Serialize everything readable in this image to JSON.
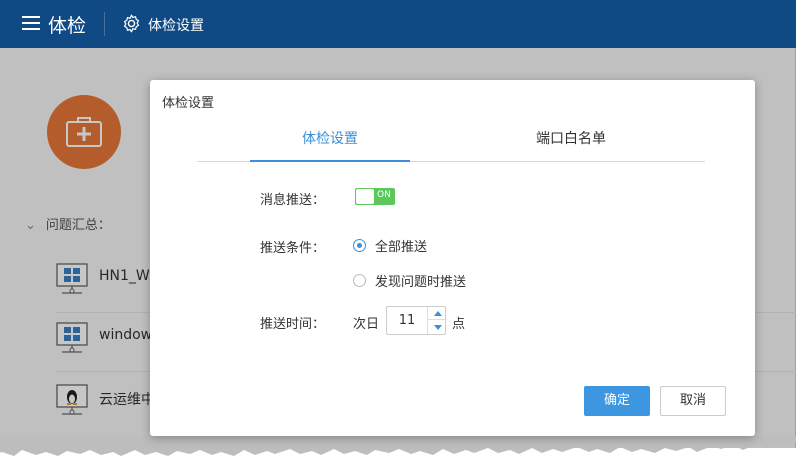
{
  "header": {
    "app_title": "体检",
    "breadcrumb": "体检设置"
  },
  "background": {
    "summary_label": "问题汇总：",
    "rows": [
      {
        "name": "HN1_W",
        "os": "windows-icon"
      },
      {
        "name": "window",
        "os": "windows-icon"
      },
      {
        "name": "云运维中",
        "os": "linux-icon"
      }
    ]
  },
  "dialog": {
    "title": "体检设置",
    "tabs": [
      {
        "label": "体检设置",
        "active": true
      },
      {
        "label": "端口白名单",
        "active": false
      }
    ],
    "push_message": {
      "label": "消息推送：",
      "toggle_text": "ON",
      "enabled": true
    },
    "push_condition": {
      "label": "推送条件：",
      "options": [
        {
          "label": "全部推送",
          "checked": true
        },
        {
          "label": "发现问题时推送",
          "checked": false
        }
      ]
    },
    "push_time": {
      "label": "推送时间：",
      "prefix": "次日",
      "hour": "11",
      "unit": "点"
    },
    "buttons": {
      "ok": "确定",
      "cancel": "取消"
    }
  },
  "colors": {
    "header_bg": "#104a85",
    "accent": "#3c8fd6",
    "toggle_on": "#5cc85c",
    "icon_orange": "#e8763a"
  }
}
